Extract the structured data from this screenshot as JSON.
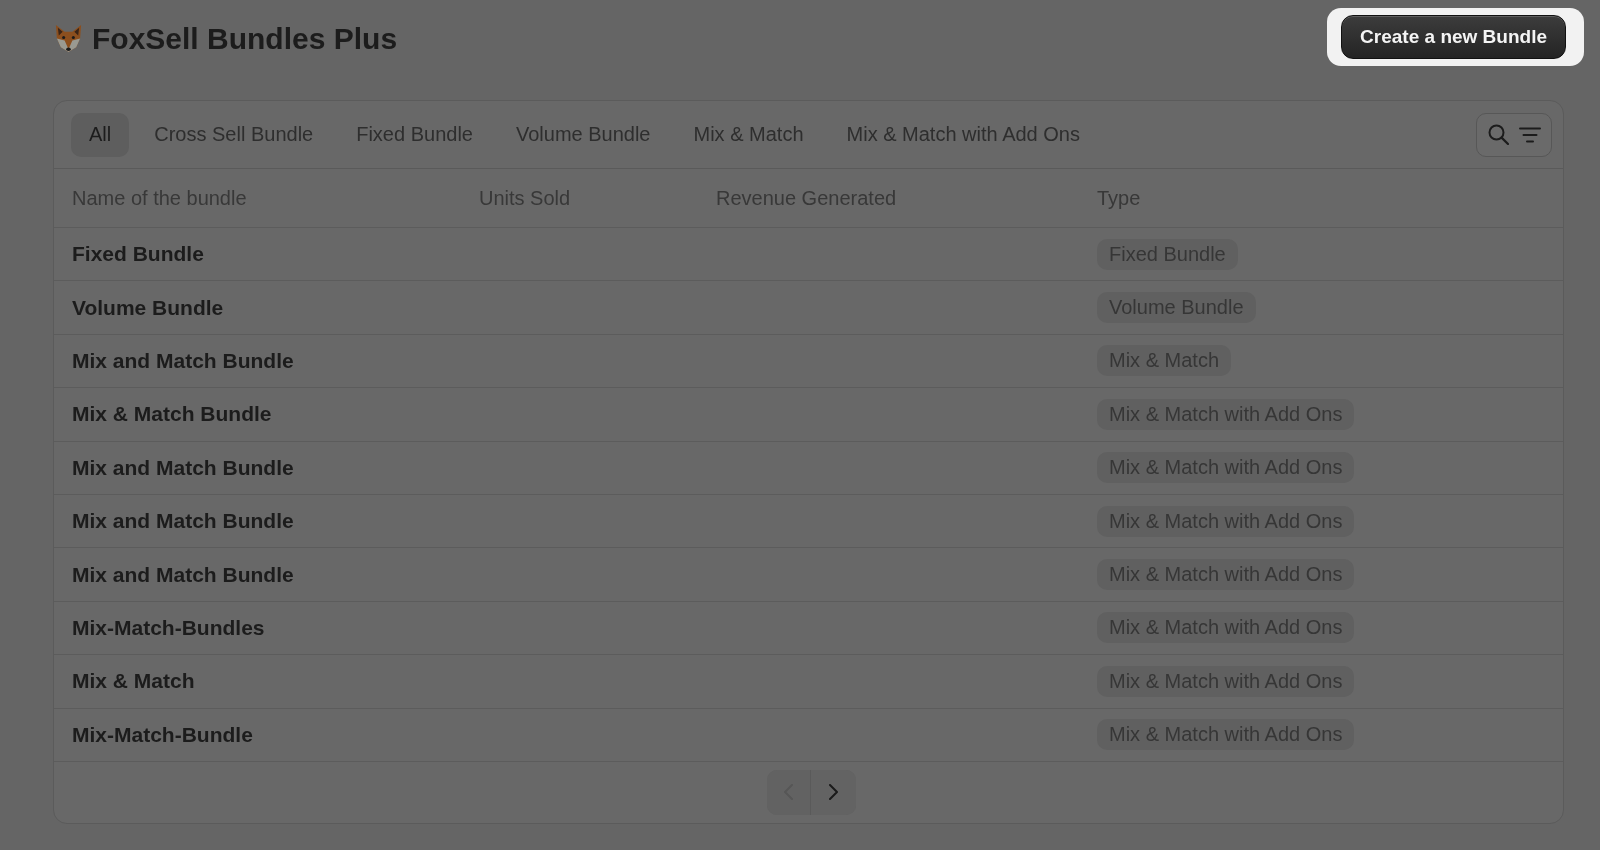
{
  "header": {
    "title": "FoxSell Bundles Plus",
    "primary_action": {
      "label": "Create a new Bundle",
      "spotlight": true
    }
  },
  "tabs": [
    {
      "label": "All",
      "selected": true
    },
    {
      "label": "Cross Sell Bundle",
      "selected": false
    },
    {
      "label": "Fixed Bundle",
      "selected": false
    },
    {
      "label": "Volume Bundle",
      "selected": false
    },
    {
      "label": "Mix & Match",
      "selected": false
    },
    {
      "label": "Mix & Match with Add Ons",
      "selected": false
    }
  ],
  "table": {
    "columns": [
      "Name of the bundle",
      "Units Sold",
      "Revenue Generated",
      "Type"
    ],
    "rows": [
      {
        "name": "Fixed Bundle",
        "type": "Fixed Bundle"
      },
      {
        "name": "Volume Bundle",
        "type": "Volume Bundle"
      },
      {
        "name": "Mix and Match Bundle",
        "type": "Mix & Match"
      },
      {
        "name": "Mix & Match Bundle",
        "type": "Mix & Match with Add Ons"
      },
      {
        "name": "Mix and Match Bundle",
        "type": "Mix & Match with Add Ons"
      },
      {
        "name": "Mix and Match Bundle",
        "type": "Mix & Match with Add Ons"
      },
      {
        "name": "Mix and Match Bundle",
        "type": "Mix & Match with Add Ons"
      },
      {
        "name": "Mix-Match-Bundles",
        "type": "Mix & Match with Add Ons"
      },
      {
        "name": "Mix & Match",
        "type": "Mix & Match with Add Ons"
      },
      {
        "name": "Mix-Match-Bundle",
        "type": "Mix & Match with Add Ons"
      }
    ]
  },
  "pagination": {
    "previous": {
      "disabled": true
    },
    "next": {
      "disabled": false
    }
  }
}
